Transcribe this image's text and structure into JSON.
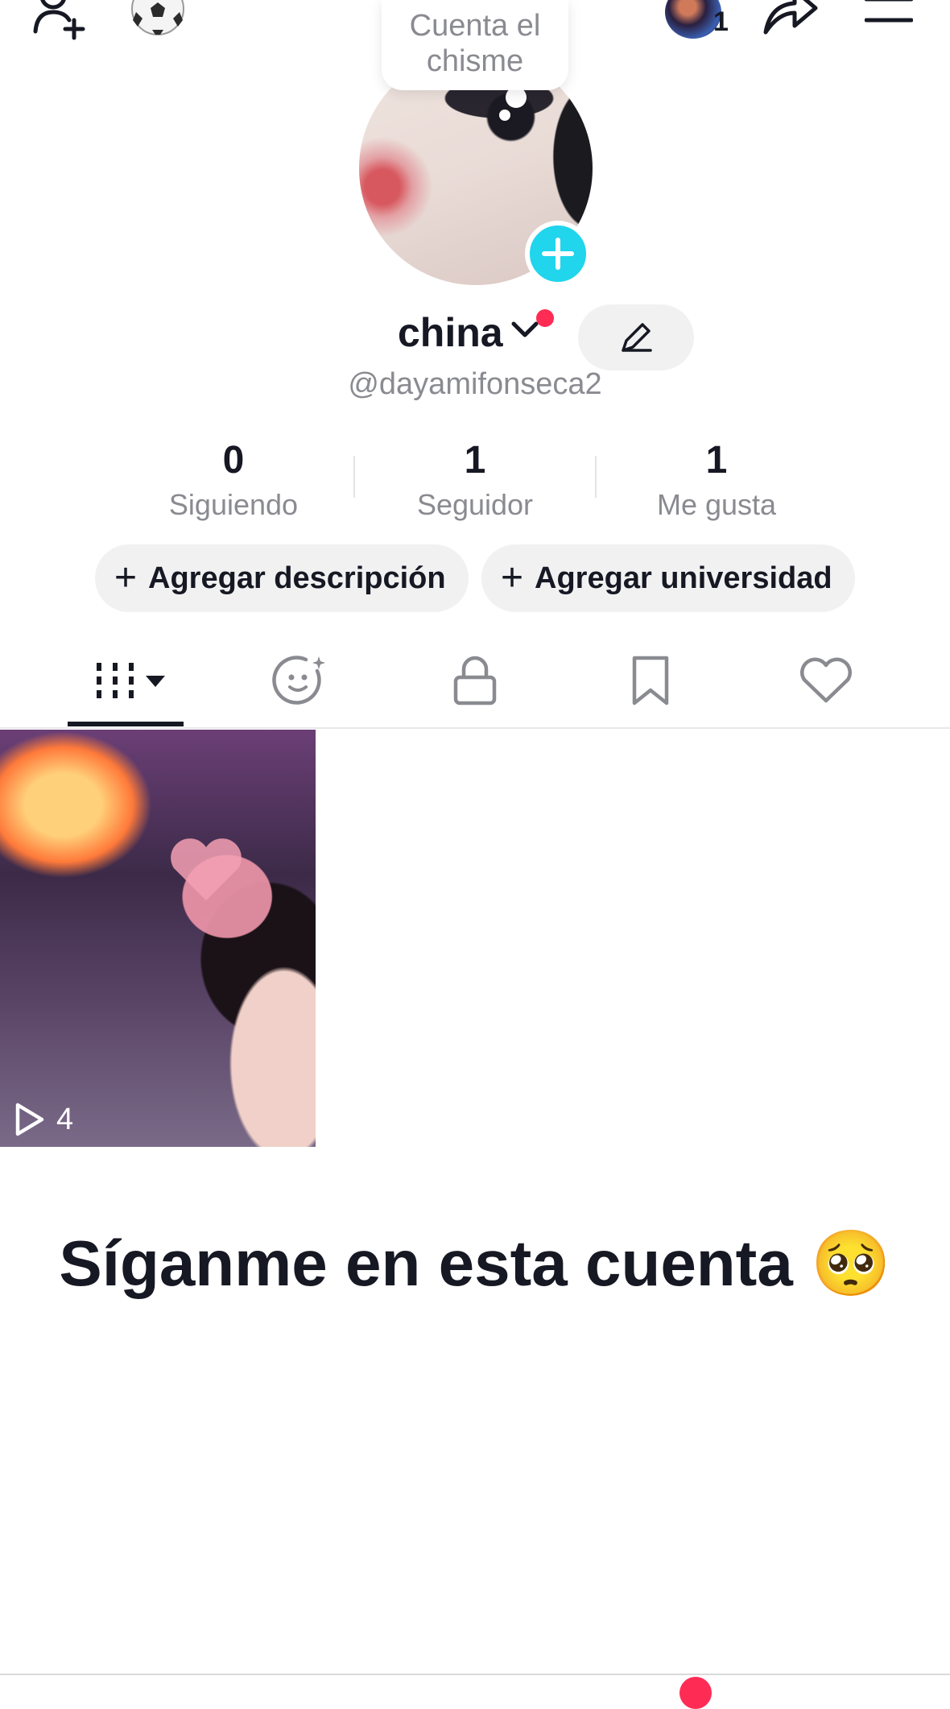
{
  "tooltip": {
    "line1": "Cuenta el",
    "line2": "chisme"
  },
  "top_bar": {
    "add_friend_icon": "person-plus-icon",
    "ball_icon": "soccer-ball-icon",
    "story_count": "1",
    "share_icon": "share-arrow-icon",
    "menu_icon": "hamburger-icon"
  },
  "profile": {
    "name": "china",
    "handle": "@dayamifonseca2"
  },
  "stats": [
    {
      "value": "0",
      "label": "Siguiendo"
    },
    {
      "value": "1",
      "label": "Seguidor"
    },
    {
      "value": "1",
      "label": "Me gusta"
    }
  ],
  "actions": {
    "add_description": "Agregar descripción",
    "add_university": "Agregar universidad"
  },
  "tabs": [
    "videos-grid-icon",
    "reposts-face-icon",
    "lock-icon",
    "bookmark-icon",
    "heart-icon"
  ],
  "video": {
    "play_count": "4"
  },
  "caption": "Síganme en esta cuenta 🥺",
  "colors": {
    "accent_cyan": "#20d5ec",
    "accent_red": "#fe2c55",
    "text_primary": "#161823",
    "text_secondary": "#8a8b91"
  }
}
